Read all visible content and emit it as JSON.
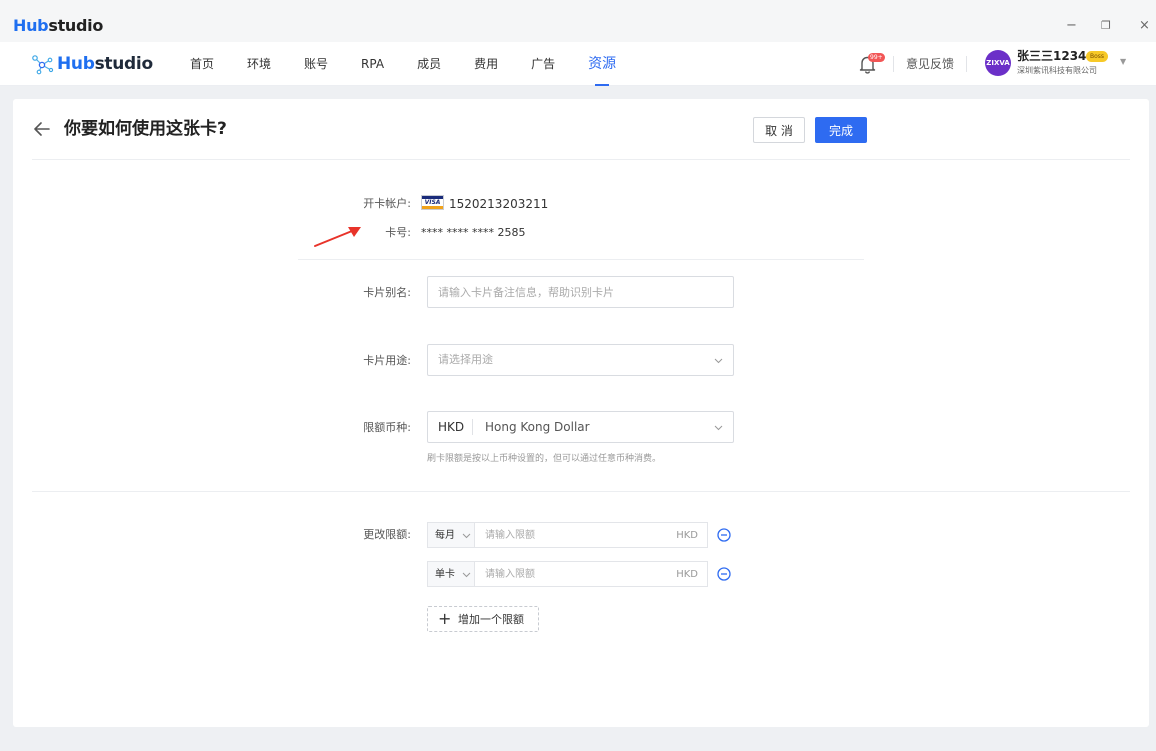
{
  "window": {
    "title_hub": "Hub",
    "title_studio": "studio",
    "controls": {
      "minimize": "−",
      "maximize": "❐",
      "close": "×"
    }
  },
  "nav": {
    "brand_hub": "Hub",
    "brand_studio": "studio",
    "items": [
      {
        "label": "首页",
        "active": false
      },
      {
        "label": "环境",
        "active": false
      },
      {
        "label": "账号",
        "active": false
      },
      {
        "label": "RPA",
        "active": false
      },
      {
        "label": "成员",
        "active": false
      },
      {
        "label": "费用",
        "active": false
      },
      {
        "label": "广告",
        "active": false
      },
      {
        "label": "资源",
        "active": true
      }
    ],
    "notification_badge": "99+",
    "feedback": "意见反馈",
    "user": {
      "avatar_text": "ZIXVA",
      "name": "张三三1234",
      "role_badge": "Boss",
      "company": "深圳紫讯科技有限公司"
    }
  },
  "page": {
    "title": "你要如何使用这张卡?",
    "cancel_label": "取 消",
    "done_label": "完成",
    "card": {
      "account_label": "开卡帐户:",
      "card_brand": "VISA",
      "account_value": "1520213203211",
      "number_label": "卡号:",
      "number_value": "**** **** **** 2585"
    },
    "alias": {
      "label": "卡片别名:",
      "placeholder": "请输入卡片备注信息，帮助识别卡片"
    },
    "usage": {
      "label": "卡片用途:",
      "placeholder": "请选择用途"
    },
    "currency": {
      "label": "限额币种:",
      "code": "HKD",
      "name": "Hong Kong Dollar",
      "hint": "刷卡限额是按以上币种设置的，但可以通过任意币种消费。"
    },
    "limits": {
      "label": "更改限额:",
      "rows": [
        {
          "period": "每月",
          "has_dropdown": true,
          "placeholder": "请输入限额",
          "unit": "HKD"
        },
        {
          "period": "单卡",
          "has_dropdown": true,
          "placeholder": "请输入限额",
          "unit": "HKD"
        }
      ],
      "add_label": "增加一个限额"
    }
  },
  "colors": {
    "accent": "#2e6bf1",
    "annotation": "#e8332a"
  }
}
